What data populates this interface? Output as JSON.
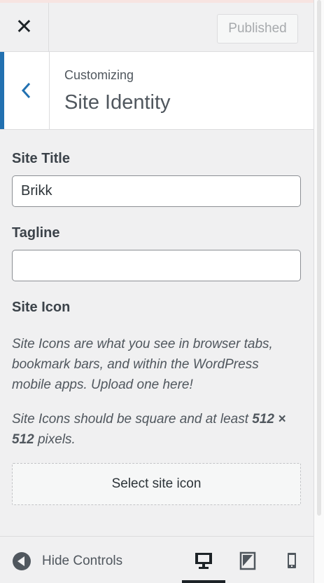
{
  "header": {
    "published_label": "Published"
  },
  "section": {
    "crumb": "Customizing",
    "title": "Site Identity"
  },
  "site_title": {
    "label": "Site Title",
    "value": "Brikk"
  },
  "tagline": {
    "label": "Tagline",
    "value": ""
  },
  "site_icon": {
    "label": "Site Icon",
    "description_1": "Site Icons are what you see in browser tabs, bookmark bars, and within the WordPress mobile apps. Upload one here!",
    "description_2_prefix": "Site Icons should be square and at least ",
    "description_2_bold_1": "512 × 512",
    "description_2_suffix": " pixels.",
    "select_button": "Select site icon"
  },
  "footer": {
    "hide_controls_label": "Hide Controls",
    "active_device": "desktop"
  },
  "colors": {
    "accent": "#2271b1",
    "background": "#f0f0f1"
  }
}
